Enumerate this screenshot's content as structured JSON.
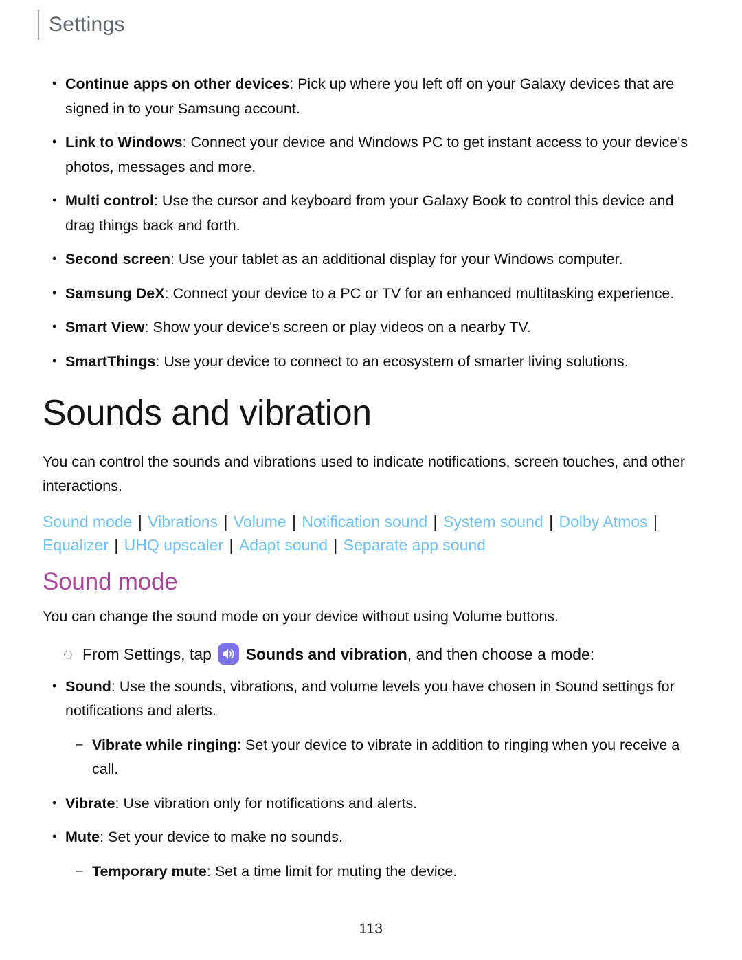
{
  "header": {
    "title": "Settings"
  },
  "connections_bullets": [
    {
      "term": "Continue apps on other devices",
      "rest": ": Pick up where you left off on your Galaxy devices that are signed in to your Samsung account."
    },
    {
      "term": "Link to Windows",
      "rest": ": Connect your device and Windows PC to get instant access to your device's photos, messages and more."
    },
    {
      "term": "Multi control",
      "rest": ": Use the cursor and keyboard from your Galaxy Book to control this device and drag things back and forth."
    },
    {
      "term": "Second screen",
      "rest": ": Use your tablet as an additional display for your Windows computer."
    },
    {
      "term": "Samsung DeX",
      "rest": ": Connect your device to a PC or TV for an enhanced multitasking experience."
    },
    {
      "term": "Smart View",
      "rest": ": Show your device's screen or play videos on a nearby TV."
    },
    {
      "term": "SmartThings",
      "rest": ": Use your device to connect to an ecosystem of smarter living solutions."
    }
  ],
  "section": {
    "heading": "Sounds and vibration",
    "intro": "You can control the sounds and vibrations used to indicate notifications, screen touches, and other interactions.",
    "link_color": "#6ec1f5",
    "separator_color": "#1c1c1c",
    "links": [
      "Sound mode",
      "Vibrations",
      "Volume",
      "Notification sound",
      "System sound",
      "Dolby Atmos",
      "Equalizer",
      "UHQ upscaler",
      "Adapt sound",
      "Separate app sound"
    ],
    "separator": "|"
  },
  "sound_mode": {
    "heading": "Sound mode",
    "heading_color": "#a8489c",
    "intro": "You can change the sound mode on your device without using Volume buttons.",
    "step": {
      "prefix": "From Settings, tap",
      "icon_name": "sounds-and-vibration-icon",
      "icon_color": "#7b72ea",
      "bold_label": "Sounds and vibration",
      "suffix": ", and then choose a mode:"
    },
    "modes": [
      {
        "term": "Sound",
        "rest": ": Use the sounds, vibrations, and volume levels you have chosen in Sound settings for notifications and alerts.",
        "level": "bullet"
      },
      {
        "term": "Vibrate while ringing",
        "rest": ": Set your device to vibrate in addition to ringing when you receive a call.",
        "level": "dash"
      },
      {
        "term": "Vibrate",
        "rest": ": Use vibration only for notifications and alerts.",
        "level": "bullet"
      },
      {
        "term": "Mute",
        "rest": ": Set your device to make no sounds.",
        "level": "bullet"
      },
      {
        "term": "Temporary mute",
        "rest": ": Set a time limit for muting the device.",
        "level": "dash"
      }
    ]
  },
  "footer": {
    "page_number": "113"
  }
}
